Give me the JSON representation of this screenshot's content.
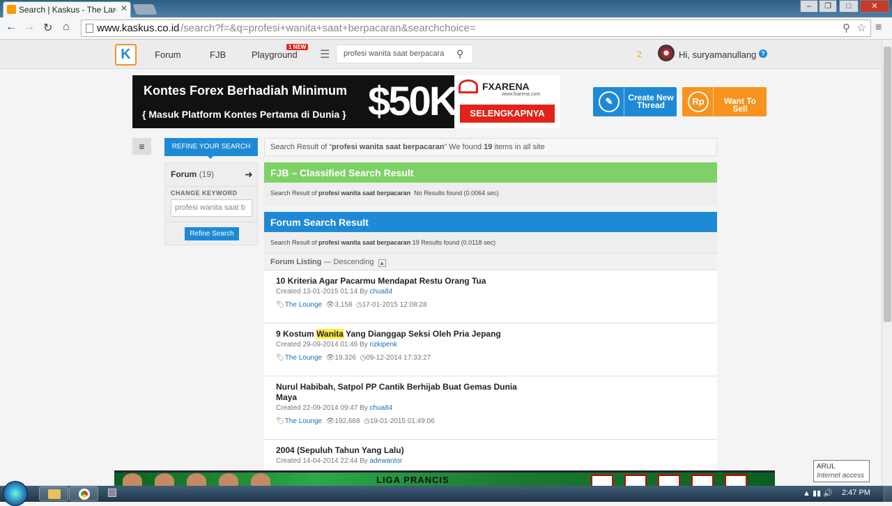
{
  "browser": {
    "tab_title": "Search | Kaskus - The Larg",
    "url_host": "www.kaskus.co.id",
    "url_path": "/search?f=&q=profesi+wanita+saat+berpacaran&searchchoice="
  },
  "header": {
    "nav": [
      "Forum",
      "FJB",
      "Playground"
    ],
    "new_badge": "1 NEW",
    "search_value": "profesi wanita saat berpacara",
    "notif_count": "2",
    "greeting": "Hi, suryamanullang"
  },
  "banner": {
    "line1": "Kontes Forex Berhadiah Minimum",
    "line2": "{ Masuk Platform Kontes Pertama di Dunia }",
    "amount": "$50K",
    "brand": "FXARENA",
    "site": "www.fxarena.com",
    "cta": "SELENGKAPNYA"
  },
  "actions": {
    "create_thread": "Create New Thread",
    "want_to_sell": "Want To Sell",
    "rp_label": "Rp"
  },
  "refine": {
    "tab_label": "REFINE YOUR SEARCH",
    "forum_label": "Forum",
    "forum_count": "(19)",
    "change_keyword": "CHANGE KEYWORD",
    "keyword_value": "profesi wanita saat b",
    "button": "Refine Search"
  },
  "results_bar": {
    "prefix": "Search Result of “",
    "query": "profesi wanita saat berpacaran",
    "middle": "” We found ",
    "count": "19",
    "suffix": " items in all site"
  },
  "fjb": {
    "heading": "FJB – Classified Search Result",
    "prefix": "Search Result of ",
    "query": "profesi wanita saat berpacaran",
    "result": "No Results found (0.0064 sec)"
  },
  "forum": {
    "heading": "Forum Search Result",
    "prefix": "Search Result of ",
    "query": "profesi wanita saat berpacaran",
    "result": "19 Results found (0.0118 sec)",
    "listing_label": "Forum Listing",
    "listing_order": "— Descending"
  },
  "threads": [
    {
      "title": "10 Kriteria Agar Pacarmu Mendapat Restu Orang Tua",
      "created": "Created 13-01-2015 01:14 By ",
      "author": "chua84",
      "category": "The Lounge",
      "views": "3,158",
      "last": "17-01-2015 12:08:28"
    },
    {
      "title_pre": "9 Kostum ",
      "title_hl": "Wanita",
      "title_post": " Yang Dianggap Seksi Oleh Pria Jepang",
      "created": "Created 29-09-2014 01:46 By ",
      "author": "rizkipenk",
      "category": "The Lounge",
      "views": "19,326",
      "last": "09-12-2014 17:33:27"
    },
    {
      "title": "Nurul Habibah, Satpol PP Cantik Berhijab Buat Gemas Dunia Maya",
      "created": "Created 22-09-2014 09:47 By ",
      "author": "chua84",
      "category": "The Lounge",
      "views": "192,668",
      "last": "19-01-2015 01:49:06"
    },
    {
      "title": "2004 (Sepuluh Tahun Yang Lalu)",
      "created": "Created 14-04-2014 22:44 By ",
      "author": "adewantor"
    }
  ],
  "ad": {
    "text": "LIGA PRANCIS"
  },
  "tooltip": {
    "title": "ARUL",
    "subtitle": "Internet access"
  },
  "taskbar": {
    "clock": "2:47 PM"
  },
  "colors": {
    "kaskus_blue": "#1e8ad6",
    "fjb_green": "#7ed167",
    "orange": "#f7931e",
    "highlight": "#ffec3d"
  },
  "icons": [
    "back-icon",
    "forward-icon",
    "reload-icon",
    "home-icon",
    "star-icon",
    "search-icon",
    "hamburger-icon",
    "eye-icon",
    "clock-icon",
    "tag-icon"
  ]
}
